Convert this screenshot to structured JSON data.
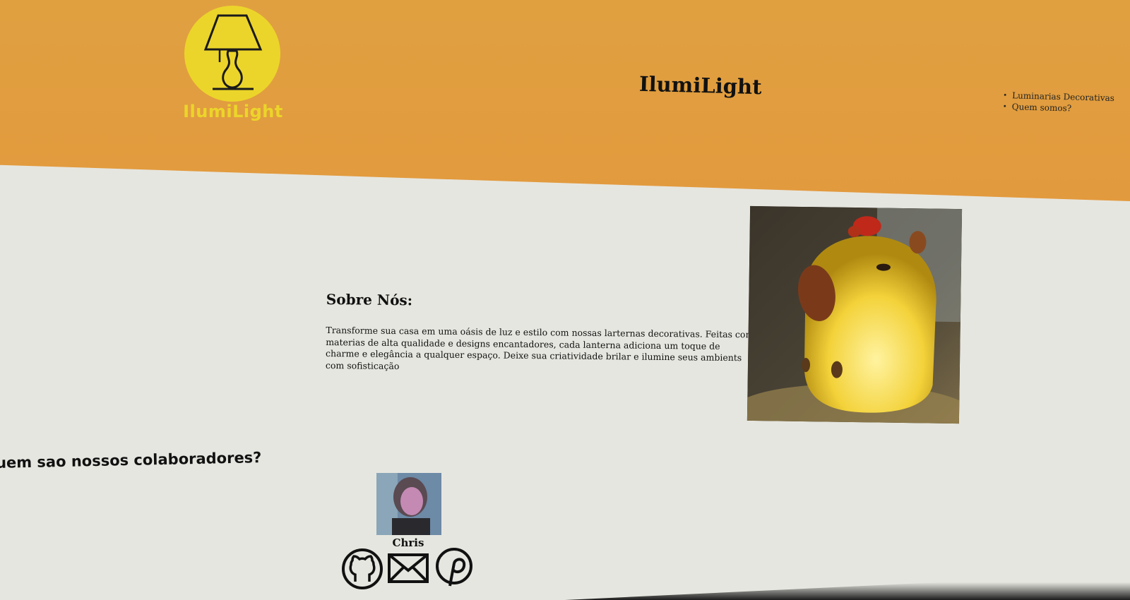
{
  "header": {
    "logo_text": "IlumiLight",
    "site_title": "IlumiLight",
    "nav": [
      "Luminarias Decorativas",
      "Quem somos?"
    ]
  },
  "about": {
    "heading": "Sobre Nós:",
    "text": "Transforme sua casa em uma oásis de luz e estilo com nossas larternas decorativas. Feitas com materias de alta qualidade e designs encantadores, cada lanterna adiciona um toque de charme e elegância a qualquer espaço. Deixe sua criatividade brilar e ilumine seus ambients com sofisticação",
    "image": "capybara-lamp-photo"
  },
  "collaborators": {
    "heading": "uem sao nossos colaboradores?",
    "people": [
      {
        "name": "Chris",
        "socials": [
          "github-icon",
          "mail-icon",
          "pinterest-icon"
        ]
      }
    ]
  },
  "colors": {
    "header": "#e0a040",
    "logo_yellow": "#ecd52a",
    "page_bg": "#e6e6e0"
  }
}
